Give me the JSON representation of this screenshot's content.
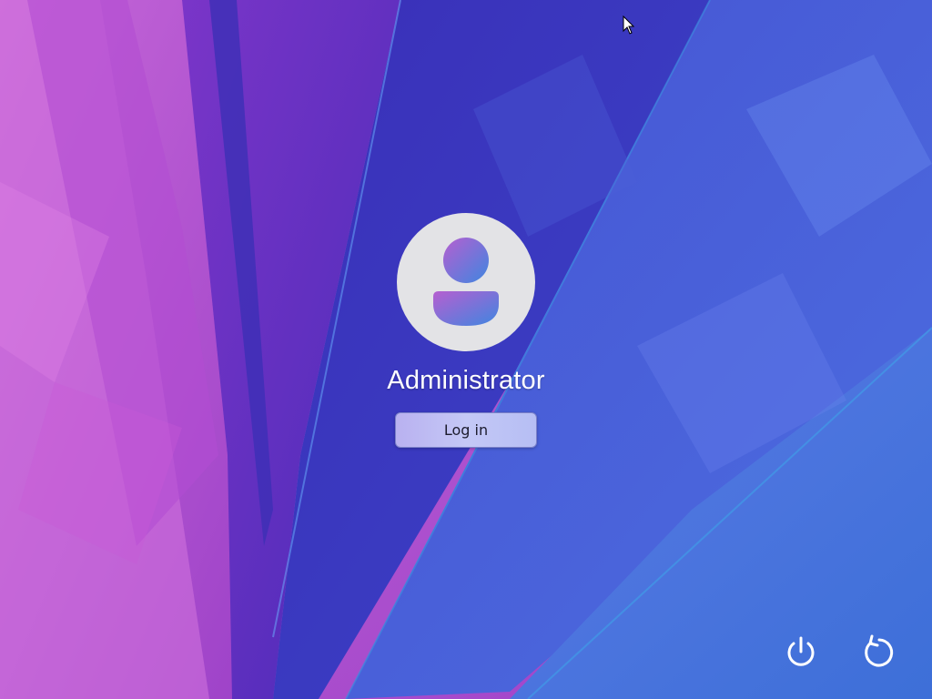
{
  "login": {
    "username": "Administrator",
    "login_button_label": "Log in"
  },
  "controls": {
    "shutdown_icon": "power-icon",
    "restart_icon": "restart-icon"
  },
  "colors": {
    "avatar_background": "#e3e3e6",
    "avatar_gradient_top": "#b65fd0",
    "avatar_gradient_bottom": "#3f86e0",
    "button_background": "#c0bdf3",
    "text_white": "#ffffff"
  }
}
